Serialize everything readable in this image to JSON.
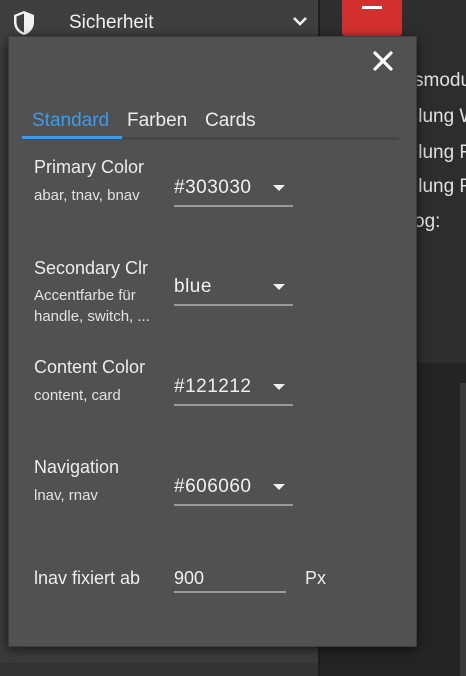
{
  "background": {
    "sidebar_label": "Sicherheit",
    "content_lines": [
      "smodu",
      "llung W",
      "llung F",
      "llung F",
      "og:"
    ],
    "minus_button_color": "#d32f2f"
  },
  "dialog": {
    "close_icon": "close-icon",
    "tabs": [
      {
        "label": "Standard",
        "active": true
      },
      {
        "label": "Farben",
        "active": false
      },
      {
        "label": "Cards",
        "active": false
      }
    ],
    "accent_color": "#3d9be9",
    "rows": [
      {
        "label": "Primary Color",
        "sub": "abar, tnav, bnav",
        "value": "#303030"
      },
      {
        "label": "Secondary Clr",
        "sub": "Accentfarbe für handle, switch, ...",
        "value": "blue"
      },
      {
        "label": "Content Color",
        "sub": "content, card",
        "value": "#121212"
      },
      {
        "label": "Navigation",
        "sub": "lnav, rnav",
        "value": "#606060"
      }
    ],
    "fixed": {
      "label": "lnav fixiert ab",
      "value": "900",
      "unit": "Px"
    }
  }
}
